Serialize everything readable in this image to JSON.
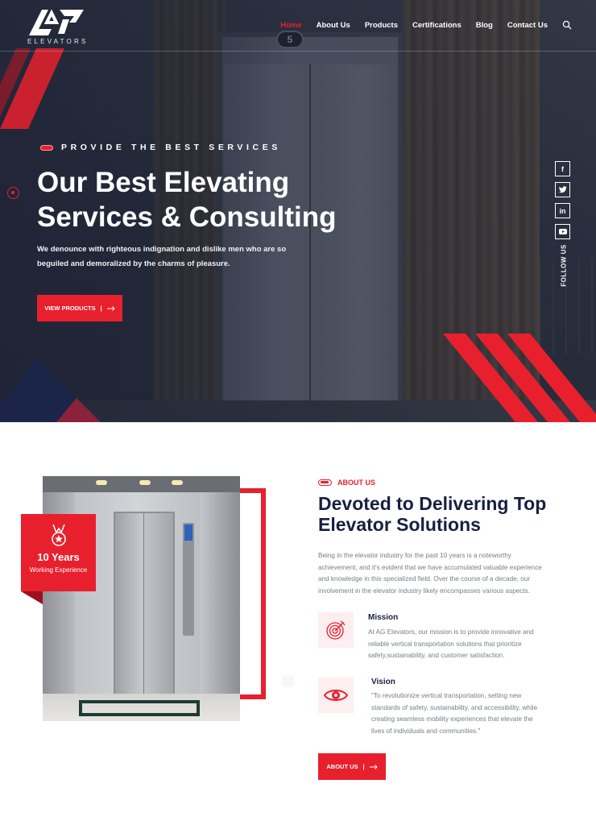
{
  "brand": {
    "wordmark": "ELEVATORS",
    "colors": {
      "accent": "#e8202e",
      "navy": "#172041",
      "hero_overlay": "#1c2234"
    }
  },
  "nav": {
    "items": [
      {
        "label": "Home",
        "active": true
      },
      {
        "label": "About Us",
        "active": false
      },
      {
        "label": "Products",
        "active": false
      },
      {
        "label": "Certifications",
        "active": false
      },
      {
        "label": "Blog",
        "active": false
      },
      {
        "label": "Contact Us",
        "active": false
      }
    ],
    "search_icon": "search-icon"
  },
  "hero": {
    "floor_indicator": "5",
    "eyebrow": "PROVIDE THE BEST SERVICES",
    "title_line1": "Our Best Elevating",
    "title_line2": "Services & Consulting",
    "subtitle_line1": "We denounce with righteous indignation and dislike men who are so",
    "subtitle_line2": "beguiled and demoralized by the charms of pleasure.",
    "button_label": "VIEW PRODUCTS",
    "button_icon": "arrow-right-icon",
    "social": {
      "icons": [
        "facebook-icon",
        "twitter-icon",
        "linkedin-icon",
        "youtube-icon"
      ],
      "glyphs": [
        "f",
        "t",
        "in",
        "▶"
      ],
      "follow_label": "FOLLOW US"
    }
  },
  "about": {
    "badge": {
      "years": "10 Years",
      "label": "Working Experience",
      "icon": "medal-icon"
    },
    "eyebrow": "ABOUT US",
    "title_line1": "Devoted to Delivering Top",
    "title_line2": "Elevator Solutions",
    "description_lines": [
      "Being in the elevator industry for the past 10 years is a noteworthy",
      "achievement, and it's evident that we have accumulated valuable experience",
      "and knowledge in this specialized field. Over the course of a decade, our",
      "involvement in the elevator industry likely encompasses various aspects."
    ],
    "mission": {
      "title": "Mission",
      "icon": "target-icon",
      "lines": [
        "At AG Elevators, our mission is to provide innovative and",
        "reliable vertical transportation solutions that prioritize",
        "safety,sustainability, and customer satisfaction."
      ]
    },
    "vision": {
      "title": "Vision",
      "icon": "eye-icon",
      "lines": [
        "\"To revolutionize vertical transportation, setting new",
        "standards of safety, sustainability, and accessibility, while",
        "creating seamless mobility experiences that elevate the",
        "lives of individuals and communities.\""
      ]
    },
    "button_label": "ABOUT US",
    "button_icon": "arrow-right-icon"
  }
}
